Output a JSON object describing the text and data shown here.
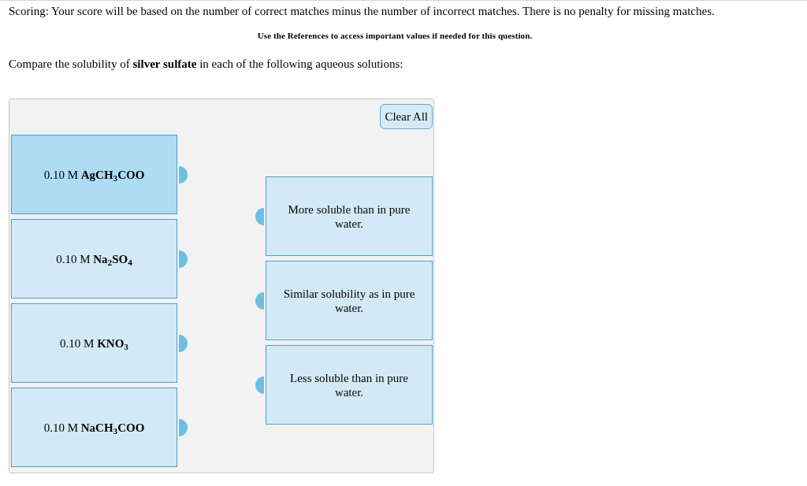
{
  "scoring_note": "Scoring: Your score will be based on the number of correct matches minus the number of incorrect matches. There is no penalty for missing matches.",
  "references_note": "Use the References to access important values if needed for this question.",
  "question": "Compare the solubility of **silver sulfate** in each of the following aqueous solutions:",
  "matching": {
    "clear_button": "Clear All",
    "left_items": [
      {
        "concentration": "0.10 M",
        "formula": "AgCH$_{3}$COO",
        "selected": true
      },
      {
        "concentration": "0.10 M",
        "formula": "Na$_{2}$SO$_{4}$",
        "selected": false
      },
      {
        "concentration": "0.10 M",
        "formula": "KNO$_{3}$",
        "selected": false
      },
      {
        "concentration": "0.10 M",
        "formula": "NaCH$_{3}$COO",
        "selected": false
      }
    ],
    "right_items": [
      {
        "label": "More soluble than in pure water.",
        "selected": false
      },
      {
        "label": "Similar solubility as in pure water.",
        "selected": false
      },
      {
        "label": "Less soluble than in pure water.",
        "selected": false
      }
    ]
  }
}
